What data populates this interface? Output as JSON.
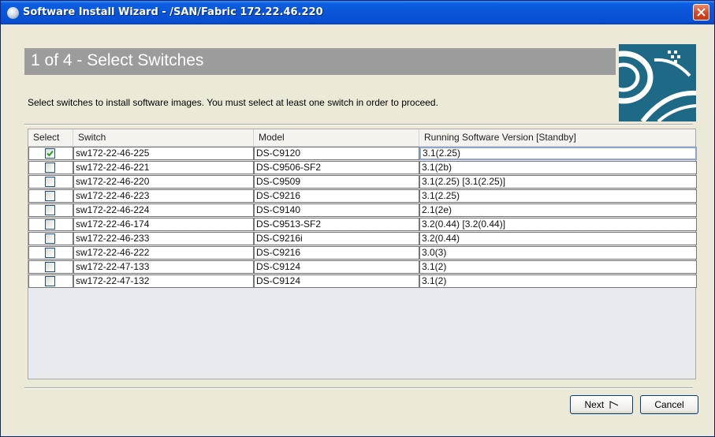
{
  "window": {
    "title": "Software Install Wizard - /SAN/Fabric 172.22.46.220"
  },
  "wizard": {
    "step_title": "1 of 4 - Select Switches",
    "instructions": "Select switches to install software images. You must select at least one switch in order to proceed."
  },
  "table": {
    "columns": [
      "Select",
      "Switch",
      "Model",
      "Running Software Version [Standby]"
    ],
    "rows": [
      {
        "selected": true,
        "switch": "sw172-22-46-225",
        "model": "DS-C9120",
        "version": "3.1(2.25)"
      },
      {
        "selected": false,
        "switch": "sw172-22-46-221",
        "model": "DS-C9506-SF2",
        "version": "3.1(2b)"
      },
      {
        "selected": false,
        "switch": "sw172-22-46-220",
        "model": "DS-C9509",
        "version": "3.1(2.25) [3.1(2.25)]"
      },
      {
        "selected": false,
        "switch": "sw172-22-46-223",
        "model": "DS-C9216",
        "version": "3.1(2.25)"
      },
      {
        "selected": false,
        "switch": "sw172-22-46-224",
        "model": "DS-C9140",
        "version": "2.1(2e)"
      },
      {
        "selected": false,
        "switch": "sw172-22-46-174",
        "model": "DS-C9513-SF2",
        "version": "3.2(0.44) [3.2(0.44)]"
      },
      {
        "selected": false,
        "switch": "sw172-22-46-233",
        "model": "DS-C9216i",
        "version": "3.2(0.44)"
      },
      {
        "selected": false,
        "switch": "sw172-22-46-222",
        "model": "DS-C9216",
        "version": "3.0(3)"
      },
      {
        "selected": false,
        "switch": "sw172-22-47-133",
        "model": "DS-C9124",
        "version": "3.1(2)"
      },
      {
        "selected": false,
        "switch": "sw172-22-47-132",
        "model": "DS-C9124",
        "version": "3.1(2)"
      }
    ]
  },
  "buttons": {
    "next_label": "Next",
    "cancel_label": "Cancel"
  },
  "colors": {
    "title_bar": "#0A54D7",
    "banner": "#9C9C9C",
    "logo": "#1E6A86",
    "dialog_bg": "#ECE9D8"
  }
}
